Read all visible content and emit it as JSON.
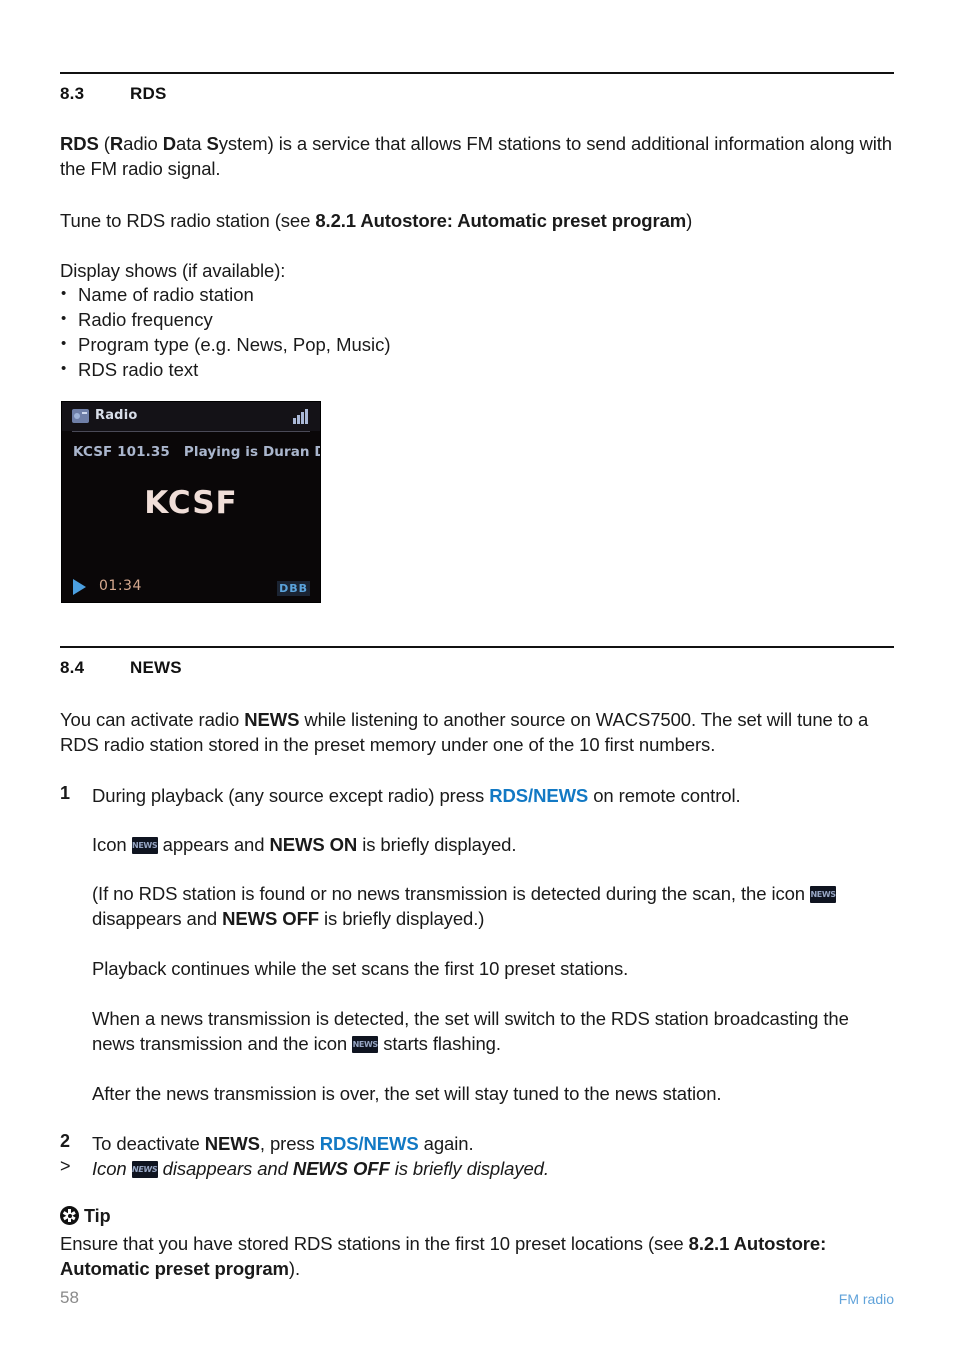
{
  "page": {
    "number": "58",
    "chapter": "FM radio",
    "accent_blue": "#1279c4",
    "footer_blue": "#61a3da"
  },
  "sections": {
    "rds": {
      "number": "8.3",
      "title": "RDS",
      "intro": {
        "lead_bold": "RDS",
        "expansion_open": " (",
        "r": "R",
        "adio": "adio ",
        "d": "D",
        "ata": "ata ",
        "s": "S",
        "ystem": "ystem)",
        "rest": " is a service that allows FM stations to send additional information along with the FM radio signal."
      },
      "tune_line": {
        "before": "Tune to RDS radio station (see ",
        "bold_ref": "8.2.1 Autostore:  Automatic preset program",
        "after": ")"
      },
      "display_shows_label": "Display shows (if available):",
      "bullets": [
        "Name of radio station",
        "Radio frequency",
        "Program type (e.g. News, Pop, Music)",
        "RDS radio text"
      ]
    },
    "news": {
      "number": "8.4",
      "title": "NEWS",
      "intro": {
        "before": "You can activate radio ",
        "bold": "NEWS",
        "after": " while listening to another source on WACS7500. The set will tune to a RDS radio station stored in the preset memory under one of the 10 first numbers."
      },
      "step1": {
        "marker": "1",
        "before": "During playback (any source except radio) press ",
        "key": "RDS/NEWS",
        "after": " on remote control."
      },
      "step1_result": {
        "before": "Icon ",
        "icon_label": "NEWS",
        "middle": " appears and ",
        "bold": "NEWS ON",
        "after": " is briefly displayed."
      },
      "step1_note": {
        "before": "(If no RDS station is found or no news transmission is detected during the scan, the icon ",
        "icon_label": "NEWS",
        "middle": " disappears and ",
        "bold": "NEWS OFF",
        "after": " is briefly displayed.)"
      },
      "playback_note": "Playback continues while the set scans the first 10 preset stations.",
      "detect_note": {
        "before": "When a news transmission is detected, the set will switch to the RDS station broadcasting the news transmission and the icon ",
        "icon_label": "NEWS",
        "after": " starts flashing."
      },
      "after_note": "After the news transmission is over, the set will stay tuned to the news station.",
      "step2": {
        "marker": "2",
        "before": "To deactivate ",
        "bold": "NEWS",
        "middle": ", press ",
        "key": "RDS/NEWS",
        "after": " again."
      },
      "step2_result": {
        "marker": ">",
        "before": "Icon ",
        "icon_label": "NEWS",
        "middle": " disappears and ",
        "bold": "NEWS OFF",
        "after": " is briefly displayed."
      }
    },
    "tip": {
      "heading": "Tip",
      "body_before": "Ensure that you have stored RDS stations in the first 10 preset locations (see ",
      "body_bold": "8.2.1 Autostore: Automatic preset program",
      "body_after": ")."
    }
  },
  "device_display": {
    "source_title": "Radio",
    "rds_name_freq": "KCSF 101.35",
    "rds_radio_text": "Playing is Duran D",
    "station_big": "KCSF",
    "elapsed_time": "01:34",
    "dbb_badge": "DBB"
  }
}
